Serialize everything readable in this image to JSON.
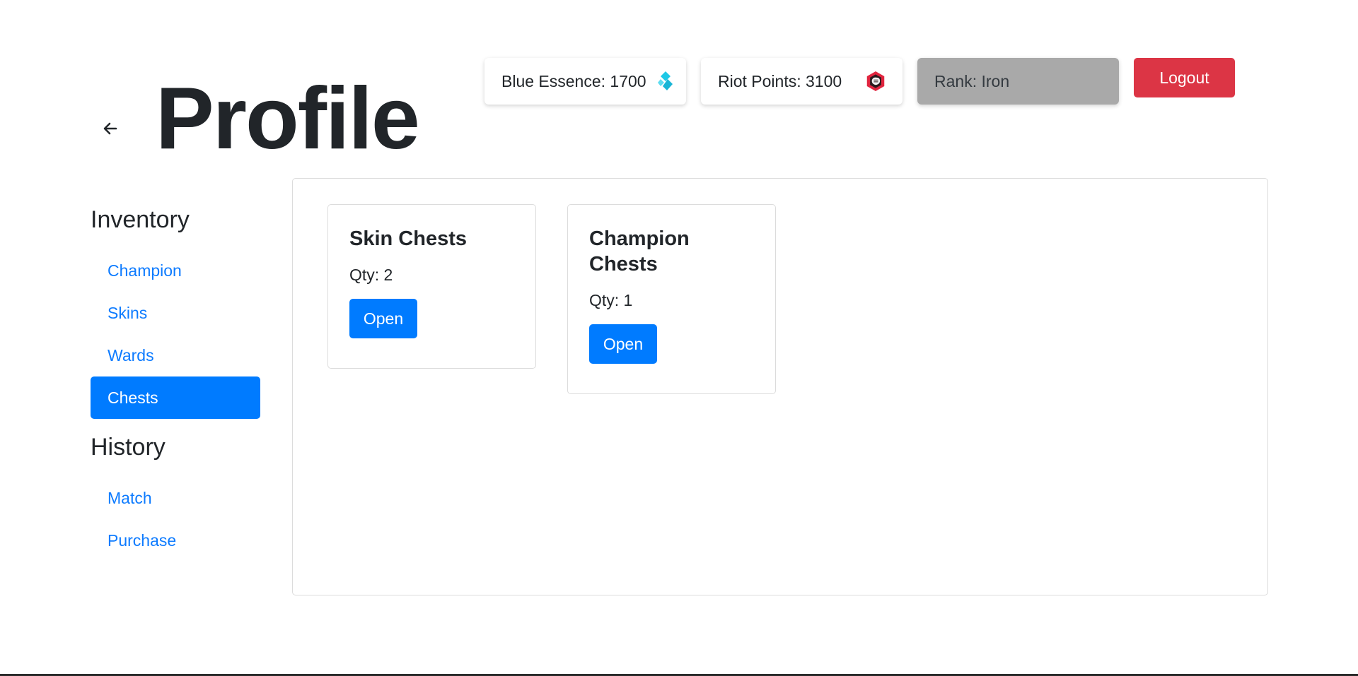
{
  "header": {
    "title": "Profile",
    "back_icon": "arrow-left-icon"
  },
  "stats": {
    "blue_essence": {
      "label": "Blue Essence: 1700",
      "icon": "blue-essence-icon",
      "color": "#1ec8e6"
    },
    "riot_points": {
      "label": "Riot Points: 3100",
      "icon": "riot-points-icon",
      "color": "#e0253f"
    },
    "rank": {
      "label": "Rank: Iron"
    }
  },
  "logout_label": "Logout",
  "sidebar": {
    "inventory": {
      "title": "Inventory",
      "items": [
        "Champion",
        "Skins",
        "Wards",
        "Chests"
      ],
      "active": "Chests"
    },
    "history": {
      "title": "History",
      "items": [
        "Match",
        "Purchase"
      ]
    }
  },
  "chests": [
    {
      "title": "Skin Chests",
      "qty": "Qty: 2",
      "button": "Open"
    },
    {
      "title": "Champion Chests",
      "qty": "Qty: 1",
      "button": "Open"
    }
  ],
  "colors": {
    "primary": "#007bff",
    "danger": "#dc3545",
    "rank_bg": "#a9a9a9"
  }
}
